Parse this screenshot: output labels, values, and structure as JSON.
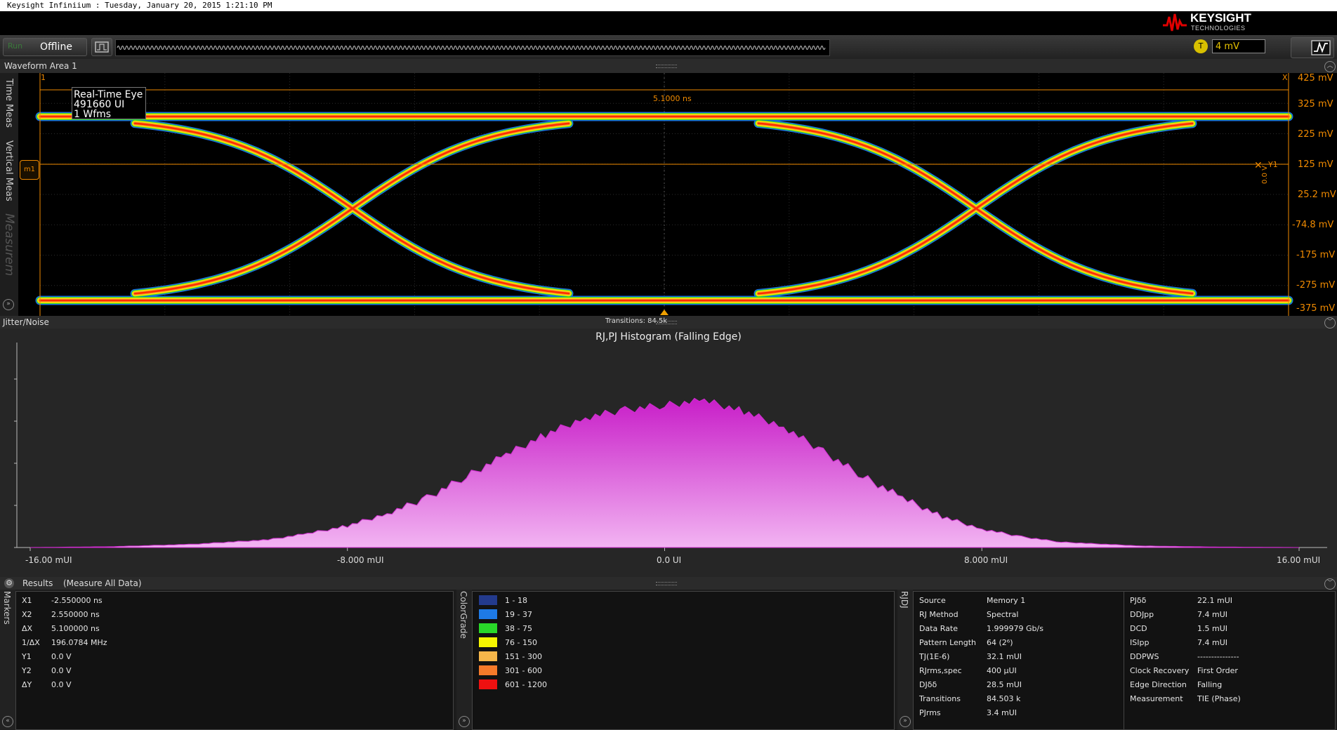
{
  "window": {
    "title": "Keysight Infiniium : Tuesday, January 20, 2015 1:21:10 PM"
  },
  "brand": {
    "name": "KEYSIGHT",
    "subtitle": "TECHNOLOGIES",
    "color": "#e00000"
  },
  "toolbar": {
    "run_label": "Run",
    "status": "Offline",
    "trigger_badge": "T",
    "trigger_level": "4 mV"
  },
  "waveform": {
    "header": "Waveform Area 1",
    "side_tabs": [
      "Time Meas",
      "Vertical Meas",
      "Measurem"
    ],
    "marker_left": "1",
    "marker_right": "X",
    "delta_label": "5.1000 ns",
    "info_box": [
      "Real-Time Eye",
      "491660 UI",
      "1 Wfms"
    ],
    "y_labels": [
      "425 mV",
      "325 mV",
      "225 mV",
      "125 mV",
      "25.2 mV",
      "-74.8 mV",
      "-175 mV",
      "-275 mV",
      "-375 mV"
    ],
    "m1_label": "m1",
    "y1_label": "Y1",
    "y_marker_value": "0.0 V",
    "colors": {
      "marker": "#f08a00",
      "eye_hot": "#ff2a00",
      "eye_warm": "#ffd000",
      "eye_edge": "#2aa0ff"
    }
  },
  "jitter": {
    "header": "Jitter/Noise",
    "chart_title": "RJ,PJ Histogram (Falling Edge)",
    "annotation": "Transitions: 84.5k",
    "x_labels": [
      "-16.00 mUI",
      "-8.000 mUI",
      "0.0 UI",
      "8.000 mUI",
      "16.00 mUI"
    ],
    "fill_color": "#d02cd0"
  },
  "chart_data": {
    "type": "area",
    "title": "RJ,PJ Histogram (Falling Edge)",
    "annotations": [
      "Transitions: 84.5k"
    ],
    "xlim": [
      -16,
      16
    ],
    "x_tick_labels": [
      "-16.00 mUI",
      "-8.000 mUI",
      "0.0 UI",
      "8.000 mUI",
      "16.00 mUI"
    ],
    "ylim": [
      0,
      1.0
    ],
    "x": [
      -16,
      -14,
      -12,
      -10,
      -9,
      -8,
      -7,
      -6,
      -5,
      -4,
      -3,
      -2,
      -1,
      0,
      1,
      2,
      3,
      4,
      5,
      6,
      7,
      8,
      9,
      10,
      12,
      14,
      16
    ],
    "values": [
      0,
      0.005,
      0.02,
      0.05,
      0.09,
      0.14,
      0.22,
      0.32,
      0.46,
      0.6,
      0.73,
      0.84,
      0.89,
      0.92,
      0.95,
      0.88,
      0.78,
      0.62,
      0.46,
      0.32,
      0.2,
      0.12,
      0.07,
      0.035,
      0.01,
      0.003,
      0
    ]
  },
  "results": {
    "header": "Results",
    "mode": "(Measure All Data)",
    "tabs": [
      "Markers",
      "ColorGrade",
      "RJDJ"
    ],
    "markers": [
      {
        "label": "X1",
        "value": "-2.550000 ns"
      },
      {
        "label": "X2",
        "value": "2.550000 ns"
      },
      {
        "label": "ΔX",
        "value": "5.100000 ns"
      },
      {
        "label": "1/ΔX",
        "value": "196.0784 MHz"
      },
      {
        "label": "Y1",
        "value": "0.0 V"
      },
      {
        "label": "Y2",
        "value": "0.0 V"
      },
      {
        "label": "ΔY",
        "value": "0.0 V"
      }
    ],
    "colorgrade": [
      {
        "range": "1 - 18",
        "color": "#233a8c"
      },
      {
        "range": "19 - 37",
        "color": "#1e7ae6"
      },
      {
        "range": "38 - 75",
        "color": "#29d829"
      },
      {
        "range": "76 - 150",
        "color": "#f6f600"
      },
      {
        "range": "151 - 300",
        "color": "#f5b64a"
      },
      {
        "range": "301 - 600",
        "color": "#f57a2a"
      },
      {
        "range": "601 - 1200",
        "color": "#ee1010"
      }
    ],
    "rjdj_left": [
      {
        "label": "Source",
        "value": "Memory 1"
      },
      {
        "label": "RJ Method",
        "value": "Spectral"
      },
      {
        "label": "Data Rate",
        "value": "1.999979 Gb/s"
      },
      {
        "label": "Pattern Length",
        "value": "64 (2⁶)"
      },
      {
        "label": " TJ(1E-6)",
        "value": "32.1 mUI"
      },
      {
        "label": "RJrms,spec",
        "value": "400 µUI"
      },
      {
        "label": "DJδδ",
        "value": "28.5 mUI"
      },
      {
        "label": "Transitions",
        "value": "84.503 k"
      },
      {
        "label": "PJrms",
        "value": "3.4 mUI"
      }
    ],
    "rjdj_right": [
      {
        "label": "PJδδ",
        "value": "22.1 mUI"
      },
      {
        "label": "DDJpp",
        "value": "7.4 mUI"
      },
      {
        "label": "DCD",
        "value": "1.5 mUI"
      },
      {
        "label": "ISIpp",
        "value": "7.4 mUI"
      },
      {
        "label": "DDPWS",
        "value": "---------------"
      },
      {
        "label": "Clock Recovery",
        "value": "First Order"
      },
      {
        "label": "Edge Direction",
        "value": "Falling"
      },
      {
        "label": "Measurement",
        "value": "TIE (Phase)"
      }
    ]
  }
}
